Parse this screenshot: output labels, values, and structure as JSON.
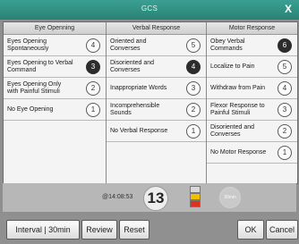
{
  "window": {
    "title": "GCS",
    "close_label": "X"
  },
  "eye": {
    "header": "Eye Openning",
    "items": [
      {
        "label": "Eyes Opening Spontaneously",
        "score": "4"
      },
      {
        "label": "Eyes Opening to Verbal Command",
        "score": "3"
      },
      {
        "label": "Eyes Opening Only with Painful Stimuli",
        "score": "2"
      },
      {
        "label": "No Eye Opening",
        "score": "1"
      }
    ]
  },
  "verbal": {
    "header": "Verbal Response",
    "items": [
      {
        "label": "Oriented and Converses",
        "score": "5"
      },
      {
        "label": "Disoriented and Converses",
        "score": "4"
      },
      {
        "label": "Inappropriate Words",
        "score": "3"
      },
      {
        "label": "Incomprehensible Sounds",
        "score": "2"
      },
      {
        "label": "No Verbal Response",
        "score": "1"
      }
    ]
  },
  "motor": {
    "header": "Motor Response",
    "items": [
      {
        "label": "Obey Verbal Commands",
        "score": "6"
      },
      {
        "label": "Localize to Pain",
        "score": "5"
      },
      {
        "label": "Withdraw from Pain",
        "score": "4"
      },
      {
        "label": "Flexor Response to Painful Stimuli",
        "score": "3"
      },
      {
        "label": "Disoriented and Converses",
        "score": "2"
      },
      {
        "label": "No Motor Response",
        "score": "1"
      }
    ]
  },
  "status": {
    "time": "@14:08:53",
    "total_score": "13",
    "interval_label": "30min"
  },
  "buttons": {
    "interval": "Interval | 30min",
    "review": "Review",
    "reset": "Reset",
    "ok": "OK",
    "cancel": "Cancel"
  },
  "colors": {
    "title_bar": "#2f8f82",
    "selected": "#2c2c2c",
    "flag_yellow": "#f0c000",
    "flag_red": "#e0301e"
  }
}
